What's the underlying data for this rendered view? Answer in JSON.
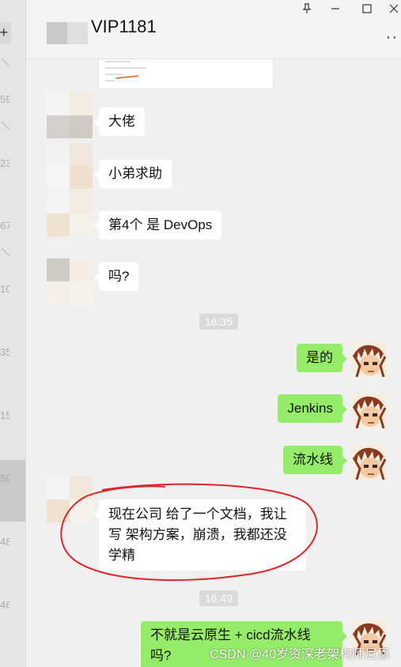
{
  "window": {
    "title": "VIP1181",
    "pin_icon": "pin-icon",
    "minimize_icon": "minimize-icon",
    "maximize_icon": "maximize-icon",
    "close_icon": "close-icon",
    "more_icon": "more-icon"
  },
  "sidebar_strip": {
    "numbers": [
      "59",
      "23",
      "67",
      "10",
      "35",
      "15",
      "59",
      "48",
      "46"
    ]
  },
  "messages": [
    {
      "side": "recv",
      "text": "大佬"
    },
    {
      "side": "recv",
      "text": "小弟求助"
    },
    {
      "side": "recv",
      "text": "第4个 是  DevOps"
    },
    {
      "side": "recv",
      "text": "吗?"
    },
    {
      "side": "time",
      "text": "16:35"
    },
    {
      "side": "sent",
      "text": "是的"
    },
    {
      "side": "sent",
      "text": "Jenkins"
    },
    {
      "side": "sent",
      "text": "流水线"
    },
    {
      "side": "recv",
      "lines": [
        "现在公司 给了一个文档，我让",
        "写 架构方案，崩溃，我都还没",
        "学精"
      ]
    },
    {
      "side": "time",
      "text": "16:49"
    },
    {
      "side": "sent",
      "lines": [
        "不就是云原生 +    cicd流水线",
        "吗?"
      ]
    }
  ],
  "watermark": "CSDN @40岁资深老架构师尼恩",
  "colors": {
    "sent_bubble": "#95ec69",
    "recv_bubble": "#ffffff",
    "highlight_oval": "#e0242a"
  }
}
